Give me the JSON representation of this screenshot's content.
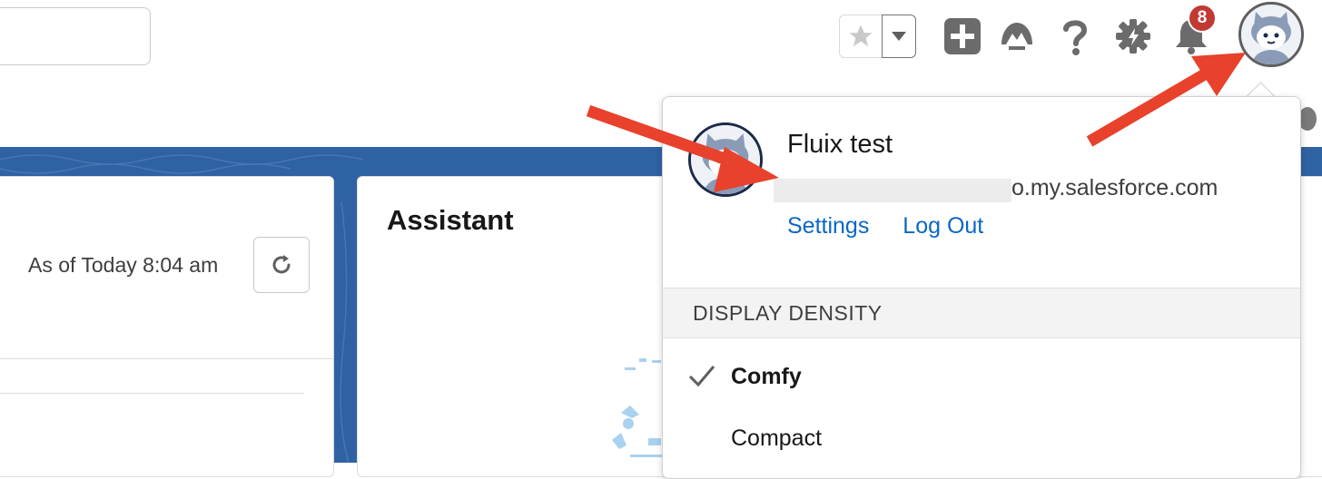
{
  "header": {
    "notification_count": "8",
    "icons": [
      "star-icon",
      "chevron-down-icon",
      "add-icon",
      "trailhead-icon",
      "help-icon",
      "gear-icon",
      "bell-icon",
      "avatar"
    ]
  },
  "left_card": {
    "as_of": "As of Today 8:04 am"
  },
  "assistant": {
    "title": "Assistant"
  },
  "user_menu": {
    "name": "Fluix test",
    "email_suffix": "o.my.salesforce.com",
    "settings_label": "Settings",
    "logout_label": "Log Out",
    "density_header": "DISPLAY DENSITY",
    "options": [
      {
        "label": "Comfy",
        "selected": true
      },
      {
        "label": "Compact",
        "selected": false
      }
    ]
  },
  "colors": {
    "link": "#0b67c7",
    "badge": "#c23934",
    "annotation_arrow": "#e8412c",
    "band": "#2f62a3"
  }
}
